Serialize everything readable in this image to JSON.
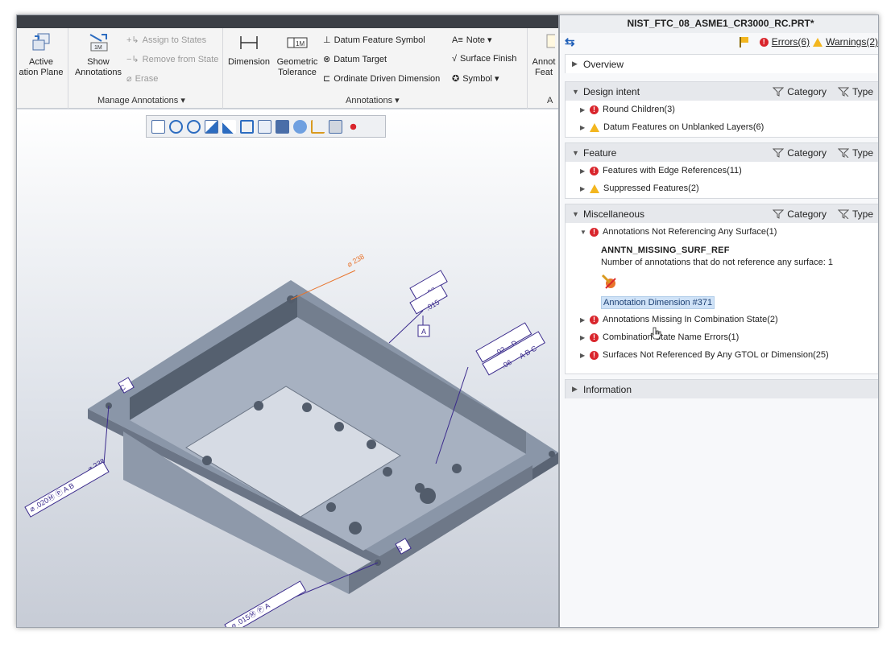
{
  "window": {
    "title": "NIST_FTC_08_ASME1_CR3000_RC.PRT*",
    "errors_label": "Errors(6)",
    "warnings_label": "Warnings(2)"
  },
  "ribbon": {
    "active_plane_label_line1": "Active",
    "active_plane_label_line2": "ation Plane",
    "show_annotations_line1": "Show",
    "show_annotations_line2": "Annotations",
    "assign_to_states": "Assign to States",
    "remove_from_state": "Remove from State",
    "erase": "Erase",
    "manage_group_label": "Manage Annotations ▾",
    "dimension": "Dimension",
    "geometric_tolerance_line1": "Geometric",
    "geometric_tolerance_line2": "Tolerance",
    "datum_feature_symbol": "Datum Feature Symbol",
    "datum_target": "Datum Target",
    "ordinate_driven_dimension": "Ordinate Driven Dimension",
    "note": "Note ▾",
    "surface_finish": "Surface Finish",
    "symbol": "Symbol ▾",
    "annotations_group_label": "Annotations ▾",
    "annotation_feature_line1": "Annot",
    "annotation_feature_line2": "Feat",
    "partial_group_label": "A"
  },
  "panel": {
    "overview": "Overview",
    "sections": [
      {
        "name": "Design intent",
        "category": "Category",
        "type": "Type",
        "items": [
          {
            "icon": "error",
            "label": "Round Children(3)"
          },
          {
            "icon": "warning",
            "label": "Datum Features on Unblanked Layers(6)"
          }
        ]
      },
      {
        "name": "Feature",
        "category": "Category",
        "type": "Type",
        "items": [
          {
            "icon": "error",
            "label": "Features with Edge References(11)"
          },
          {
            "icon": "warning",
            "label": "Suppressed Features(2)"
          }
        ]
      },
      {
        "name": "Miscellaneous",
        "category": "Category",
        "type": "Type",
        "expanded_item": {
          "label": "Annotations Not Referencing Any Surface(1)",
          "code": "ANNTN_MISSING_SURF_REF",
          "description": "Number of annotations that do not reference any surface: 1",
          "link": "Annotation Dimension #371"
        },
        "items": [
          {
            "icon": "error",
            "label": "Annotations Missing In Combination State(2)"
          },
          {
            "icon": "error",
            "label": "Combination State Name Errors(1)"
          },
          {
            "icon": "error",
            "label": "Surfaces Not Referenced By Any GTOL or Dimension(25)"
          }
        ]
      }
    ],
    "information": "Information"
  },
  "model_annotations": {
    "dim_top": "⌀ 238",
    "gtol_top_a": ".03",
    "gtol_top_b": ".015",
    "datum_a": "A",
    "gtol_right_a": ".02",
    "gtol_right_d": "D",
    "gtol_right_b": ".06",
    "gtol_right_ref": "A B C",
    "datum_c": "C",
    "dim_left": "⌀ 238",
    "gtol_left": "⌀ .020Ⓜ Ⓟ A B",
    "datum_b": "B",
    "dim_bottom": "⌀ 238",
    "gtol_bottom": "⌀ .015Ⓜ Ⓟ A"
  },
  "colors": {
    "error": "#d9252c",
    "warning": "#f3b61f",
    "selection": "#cfe2f7",
    "annotation_purple": "#3a2a8c",
    "leader_orange": "#e8742c"
  }
}
